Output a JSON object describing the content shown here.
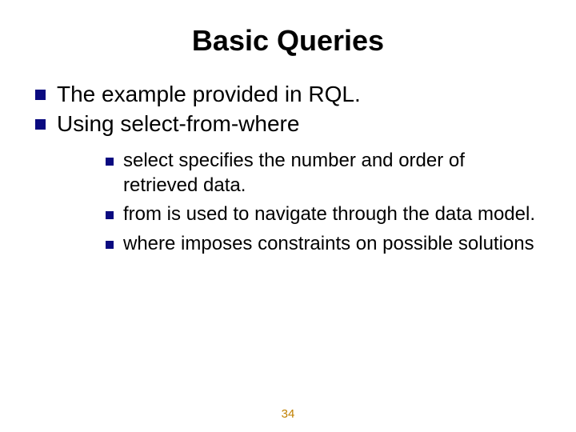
{
  "title": "Basic Queries",
  "outer": [
    "The example provided in RQL.",
    "Using select-from-where"
  ],
  "inner": [
    {
      "kw": "select",
      "rest": " specifies the number and order of retrieved data."
    },
    {
      "kw": "from",
      "rest": " is used to navigate through the data model."
    },
    {
      "kw": "where",
      "rest": " imposes constraints on possible solutions"
    }
  ],
  "page_number": "34"
}
